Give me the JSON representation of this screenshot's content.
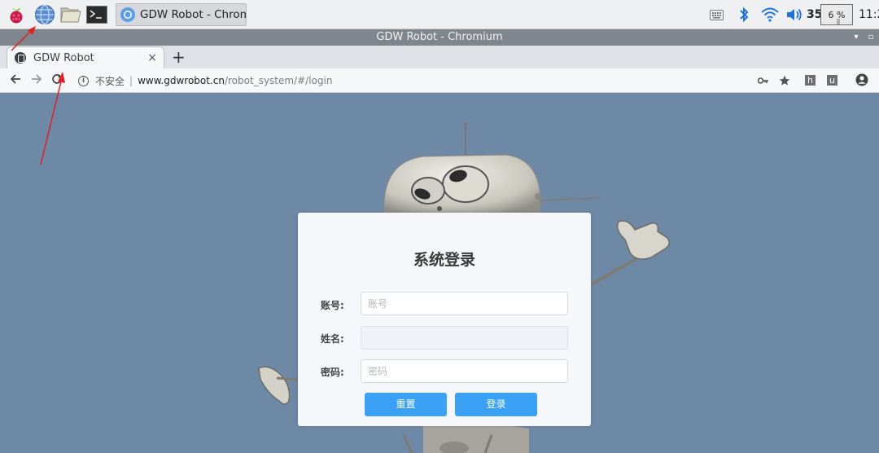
{
  "taskbar": {
    "task_title": "GDW Robot - Chromi",
    "temperature": "35",
    "cpu": "6 %",
    "clock": "11:2",
    "icons": [
      "raspberry-menu-icon",
      "web-browser-icon",
      "file-manager-icon",
      "terminal-icon",
      "keyboard-icon",
      "bluetooth-icon",
      "wifi-icon",
      "volume-icon"
    ]
  },
  "window": {
    "title": "GDW Robot - Chromium"
  },
  "browser": {
    "tab_title": "GDW Robot",
    "tab_close": "×",
    "new_tab": "+",
    "security_text": "不安全",
    "url_host": "www.gdwrobot.cn",
    "url_path": "/robot_system/#/login",
    "extension_h": "h",
    "extension_u": "u"
  },
  "login": {
    "title": "系统登录",
    "account_label": "账号:",
    "account_placeholder": "账号",
    "name_label": "姓名:",
    "name_value": "",
    "password_label": "密码:",
    "password_placeholder": "密码",
    "reset_label": "重置",
    "login_label": "登录"
  },
  "colors": {
    "page_background": "#6e89a6",
    "button_blue": "#3aa1f4",
    "annotation_arrow": "#e02020"
  }
}
